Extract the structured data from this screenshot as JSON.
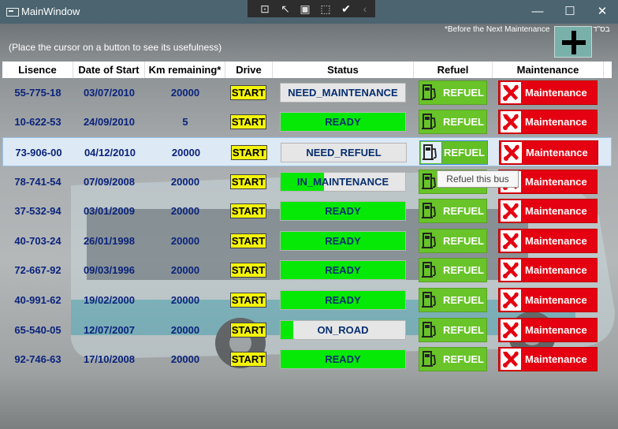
{
  "window": {
    "title": "MainWindow",
    "hebrew_tag": "בס\"ד"
  },
  "header": {
    "hint": "(Place the cursor on a button to see its usefulness)",
    "next_maintenance_note": "*Before the Next Maintenance"
  },
  "columns": [
    "Lisence",
    "Date of Start",
    "Km remaining*",
    "Drive",
    "Status",
    "Refuel",
    "Maintenance"
  ],
  "rows": [
    {
      "license": "55-775-18",
      "date": "03/07/2010",
      "km": "20000",
      "drive": "START",
      "status": "NEED_MAINTENANCE",
      "status_progress": 0,
      "refuel": "REFUEL",
      "maintenance": "Maintenance"
    },
    {
      "license": "10-622-53",
      "date": "24/09/2010",
      "km": "5",
      "drive": "START",
      "status": "READY",
      "status_progress": 1,
      "refuel": "REFUEL",
      "maintenance": "Maintenance"
    },
    {
      "license": "73-906-00",
      "date": "04/12/2010",
      "km": "20000",
      "drive": "START",
      "status": "NEED_REFUEL",
      "status_progress": 0,
      "refuel": "REFUEL",
      "maintenance": "Maintenance"
    },
    {
      "license": "78-741-54",
      "date": "07/09/2008",
      "km": "20000",
      "drive": "START",
      "status": "IN_MAINTENANCE",
      "status_progress": 0.35,
      "refuel": "REFUEL",
      "maintenance": "Maintenance"
    },
    {
      "license": "37-532-94",
      "date": "03/01/2009",
      "km": "20000",
      "drive": "START",
      "status": "READY",
      "status_progress": 1,
      "refuel": "REFUEL",
      "maintenance": "Maintenance"
    },
    {
      "license": "40-703-24",
      "date": "26/01/1998",
      "km": "20000",
      "drive": "START",
      "status": "READY",
      "status_progress": 1,
      "refuel": "REFUEL",
      "maintenance": "Maintenance"
    },
    {
      "license": "72-667-92",
      "date": "09/03/1996",
      "km": "20000",
      "drive": "START",
      "status": "READY",
      "status_progress": 1,
      "refuel": "REFUEL",
      "maintenance": "Maintenance"
    },
    {
      "license": "40-991-62",
      "date": "19/02/2000",
      "km": "20000",
      "drive": "START",
      "status": "READY",
      "status_progress": 1,
      "refuel": "REFUEL",
      "maintenance": "Maintenance"
    },
    {
      "license": "65-540-05",
      "date": "12/07/2007",
      "km": "20000",
      "drive": "START",
      "status": "ON_ROAD",
      "status_progress": 0.1,
      "refuel": "REFUEL",
      "maintenance": "Maintenance"
    },
    {
      "license": "92-746-63",
      "date": "17/10/2008",
      "km": "20000",
      "drive": "START",
      "status": "READY",
      "status_progress": 1,
      "refuel": "REFUEL",
      "maintenance": "Maintenance"
    }
  ],
  "tooltip": "Refuel this bus",
  "colors": {
    "titlebar": "#4b6470",
    "status_fill": "#06e906",
    "refuel": "#68c428",
    "maintenance": "#e40010",
    "drive": "#f4f40a",
    "text_blue": "#0a237c"
  }
}
